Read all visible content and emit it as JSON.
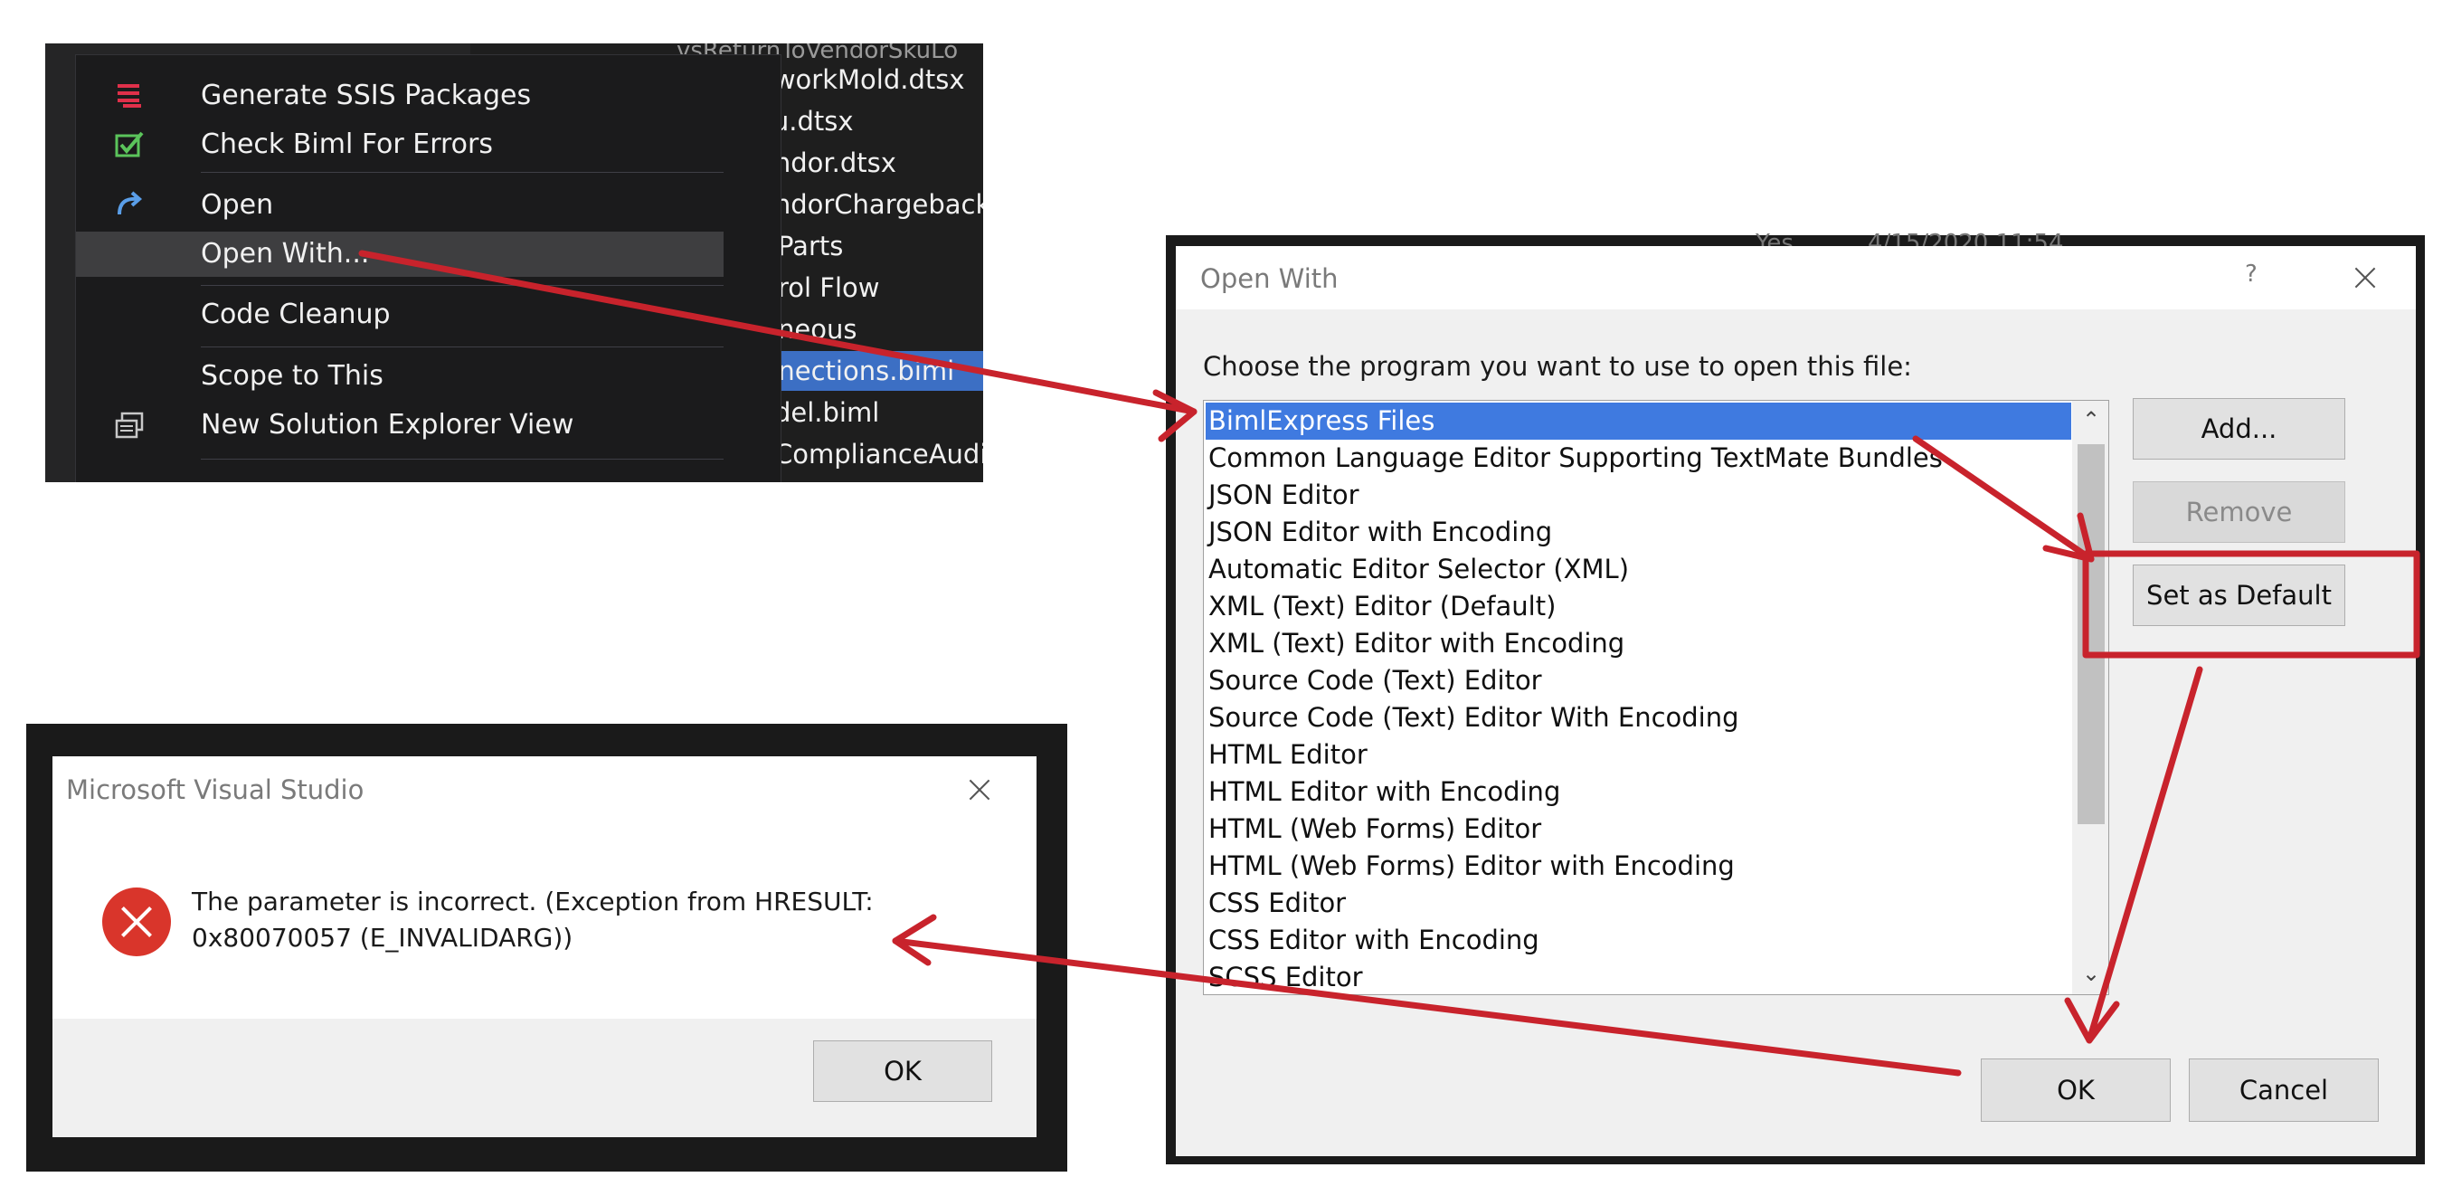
{
  "solution_explorer": {
    "tree_items": [
      "vsReturnToVendorSkuLo",
      "eworkMold.dtsx",
      "ku.dtsx",
      "endor.dtsx",
      "endorChargebackProj",
      "Parts",
      "rol Flow",
      "neous",
      "nnections.biml",
      "del.biml",
      "ComplianceAudit.bim"
    ]
  },
  "context_menu": {
    "items": [
      {
        "label": "Generate SSIS Packages",
        "icon": "ssis-packages-icon"
      },
      {
        "label": "Check Biml For Errors",
        "icon": "check-icon"
      },
      {
        "label": "Open",
        "icon": "open-arrow-icon"
      },
      {
        "label": "Open With...",
        "icon": ""
      },
      {
        "label": "Code Cleanup",
        "icon": ""
      },
      {
        "label": "Scope to This",
        "icon": ""
      },
      {
        "label": "New Solution Explorer View",
        "icon": "solution-view-icon"
      }
    ]
  },
  "open_with_dialog": {
    "title": "Open With",
    "help": "?",
    "prompt": "Choose the program you want to use to open this file:",
    "programs": [
      "BimlExpress Files",
      "Common Language Editor Supporting TextMate Bundles",
      "JSON Editor",
      "JSON Editor with Encoding",
      "Automatic Editor Selector (XML)",
      "XML (Text) Editor (Default)",
      "XML (Text) Editor with Encoding",
      "Source Code (Text) Editor",
      "Source Code (Text) Editor With Encoding",
      "HTML Editor",
      "HTML Editor with Encoding",
      "HTML (Web Forms) Editor",
      "HTML (Web Forms) Editor with Encoding",
      "CSS Editor",
      "CSS Editor with Encoding",
      "SCSS Editor"
    ],
    "selected_program": "BimlExpress Files",
    "buttons": {
      "add": "Add...",
      "remove": "Remove",
      "set_default": "Set as Default",
      "ok": "OK",
      "cancel": "Cancel"
    },
    "background_text": {
      "yes": "Yes",
      "date": "4/15/2020 11:54"
    }
  },
  "error_dialog": {
    "title": "Microsoft Visual Studio",
    "message": "The parameter is incorrect. (Exception from HRESULT: 0x80070057 (E_INVALIDARG))",
    "ok": "OK"
  },
  "colors": {
    "annotation_red": "#c8232c",
    "selection_blue": "#3f7ae0",
    "vs_dark": "#252526",
    "error_red": "#d9352b"
  }
}
